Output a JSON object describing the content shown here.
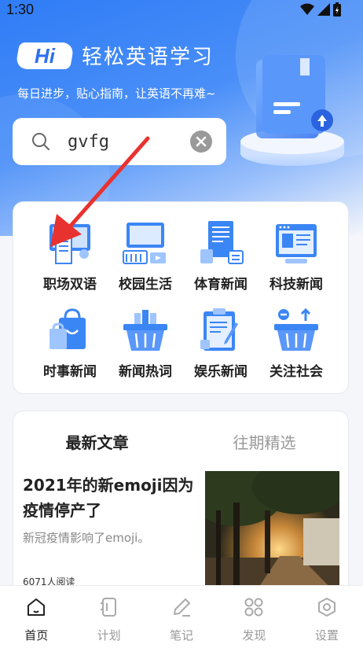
{
  "status_bar": {
    "time": "1:30"
  },
  "brand": {
    "badge": "Hi",
    "title": "轻松英语学习",
    "slogan": "每日进步，贴心指南，让英语不再难~"
  },
  "search": {
    "value": "gvfg"
  },
  "categories": [
    {
      "label": "职场双语",
      "icon": "office-icon"
    },
    {
      "label": "校园生活",
      "icon": "campus-monitor-icon"
    },
    {
      "label": "体育新闻",
      "icon": "sports-news-icon"
    },
    {
      "label": "科技新闻",
      "icon": "tech-news-icon"
    },
    {
      "label": "时事新闻",
      "icon": "shopping-bag-icon"
    },
    {
      "label": "新闻热词",
      "icon": "basket-icon"
    },
    {
      "label": "娱乐新闻",
      "icon": "clipboard-icon"
    },
    {
      "label": "关注社会",
      "icon": "basket-arrows-icon"
    }
  ],
  "article_tabs": {
    "latest": "最新文章",
    "past": "往期精选"
  },
  "article": {
    "title": "2021年的新emoji因为疫情停产了",
    "desc": "新冠疫情影响了emoji。",
    "reads": "6071人阅读"
  },
  "tabbar": [
    {
      "label": "首页",
      "icon": "home-icon"
    },
    {
      "label": "计划",
      "icon": "plan-icon"
    },
    {
      "label": "笔记",
      "icon": "note-icon"
    },
    {
      "label": "发现",
      "icon": "discover-icon"
    },
    {
      "label": "设置",
      "icon": "settings-icon"
    }
  ],
  "colors": {
    "primary": "#2f7cf6",
    "accent_red": "#e8322f"
  }
}
